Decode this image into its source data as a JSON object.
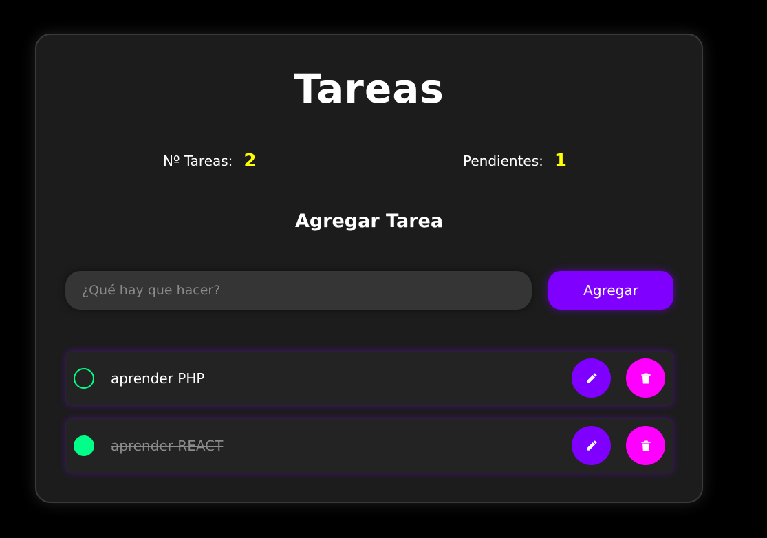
{
  "header": {
    "title": "Tareas"
  },
  "stats": {
    "total_label": "Nº Tareas:",
    "total_value": "2",
    "pending_label": "Pendientes:",
    "pending_value": "1"
  },
  "add_section": {
    "title": "Agregar Tarea",
    "input_placeholder": "¿Qué hay que hacer?",
    "input_value": "",
    "button_label": "Agregar"
  },
  "tasks": [
    {
      "text": "aprender PHP",
      "completed": false
    },
    {
      "text": "aprender REACT",
      "completed": true
    }
  ],
  "icons": {
    "edit": "edit-icon",
    "delete": "trash-icon",
    "status_open": "circle-outline-icon",
    "status_done": "circle-filled-icon"
  },
  "colors": {
    "page_background": "#000000",
    "card_background": "#1c1c1c",
    "accent_purple": "#8000ff",
    "accent_magenta": "#ff00ff",
    "accent_green": "#00ff88",
    "stat_yellow": "#ffff00"
  }
}
